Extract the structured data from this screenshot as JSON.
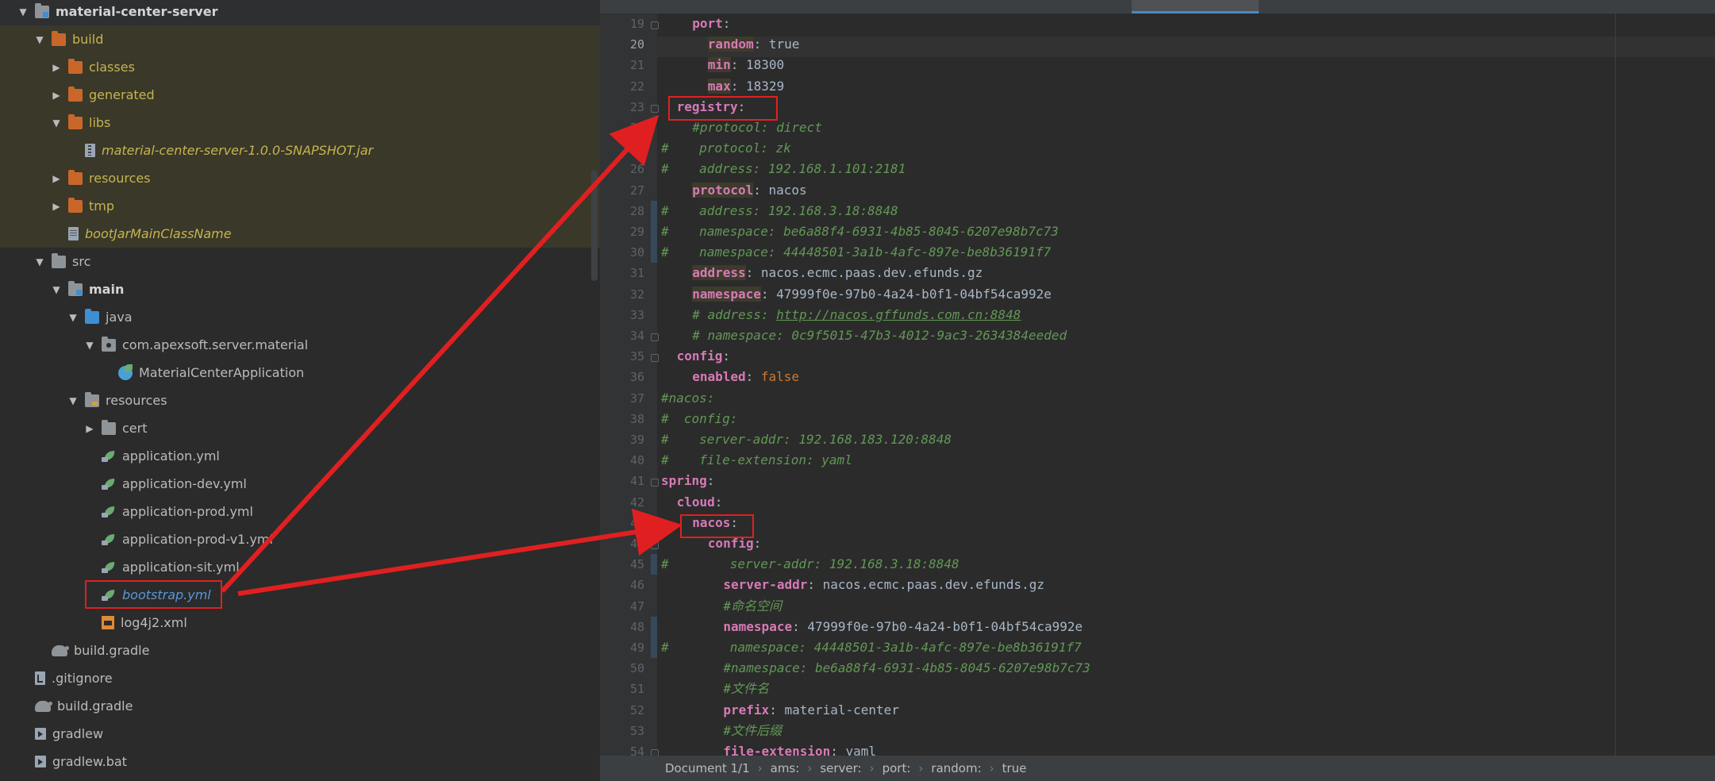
{
  "tree": {
    "items": [
      {
        "label": "material-center-server",
        "depth": 0,
        "expanded": true,
        "icon": "module-folder-icon",
        "style": "bold"
      },
      {
        "label": "build",
        "depth": 1,
        "expanded": true,
        "icon": "folder-orange-icon",
        "style": "yellow"
      },
      {
        "label": "classes",
        "depth": 2,
        "expanded": false,
        "icon": "folder-orange-icon",
        "style": "yellow"
      },
      {
        "label": "generated",
        "depth": 2,
        "expanded": false,
        "icon": "folder-orange-icon",
        "style": "yellow"
      },
      {
        "label": "libs",
        "depth": 2,
        "expanded": true,
        "icon": "folder-orange-icon",
        "style": "yellow"
      },
      {
        "label": "material-center-server-1.0.0-SNAPSHOT.jar",
        "depth": 3,
        "expanded": null,
        "icon": "jar-file-icon",
        "style": "yellow"
      },
      {
        "label": "resources",
        "depth": 2,
        "expanded": false,
        "icon": "folder-orange-icon",
        "style": "yellow"
      },
      {
        "label": "tmp",
        "depth": 2,
        "expanded": false,
        "icon": "folder-orange-icon",
        "style": "yellow"
      },
      {
        "label": "bootJarMainClassName",
        "depth": 2,
        "expanded": null,
        "icon": "generic-file-icon",
        "style": "yellow"
      },
      {
        "label": "src",
        "depth": 1,
        "expanded": true,
        "icon": "folder-gray-icon",
        "style": "white"
      },
      {
        "label": "main",
        "depth": 2,
        "expanded": true,
        "icon": "module-folder-icon",
        "style": "bold"
      },
      {
        "label": "java",
        "depth": 3,
        "expanded": true,
        "icon": "folder-blue-icon",
        "style": "white"
      },
      {
        "label": "com.apexsoft.server.material",
        "depth": 4,
        "expanded": true,
        "icon": "package-icon",
        "style": "white"
      },
      {
        "label": "MaterialCenterApplication",
        "depth": 5,
        "expanded": null,
        "icon": "spring-app-icon",
        "style": "white"
      },
      {
        "label": "resources",
        "depth": 3,
        "expanded": true,
        "icon": "resources-folder-icon",
        "style": "white"
      },
      {
        "label": "cert",
        "depth": 4,
        "expanded": false,
        "icon": "folder-gray-icon",
        "style": "white"
      },
      {
        "label": "application.yml",
        "depth": 4,
        "expanded": null,
        "icon": "spring-yml-icon",
        "style": "white"
      },
      {
        "label": "application-dev.yml",
        "depth": 4,
        "expanded": null,
        "icon": "spring-yml-icon",
        "style": "white"
      },
      {
        "label": "application-prod.yml",
        "depth": 4,
        "expanded": null,
        "icon": "spring-yml-icon",
        "style": "white"
      },
      {
        "label": "application-prod-v1.yml",
        "depth": 4,
        "expanded": null,
        "icon": "spring-yml-icon",
        "style": "white"
      },
      {
        "label": "application-sit.yml",
        "depth": 4,
        "expanded": null,
        "icon": "spring-yml-icon",
        "style": "white"
      },
      {
        "label": "bootstrap.yml",
        "depth": 4,
        "expanded": null,
        "icon": "spring-yml-icon",
        "style": "blue"
      },
      {
        "label": "log4j2.xml",
        "depth": 4,
        "expanded": null,
        "icon": "xml-file-icon",
        "style": "white"
      },
      {
        "label": "build.gradle",
        "depth": 1,
        "expanded": null,
        "icon": "gradle-icon",
        "style": "white"
      },
      {
        "label": ".gitignore",
        "depth": 0,
        "expanded": null,
        "icon": "gitignore-icon",
        "style": "white"
      },
      {
        "label": "build.gradle",
        "depth": 0,
        "expanded": null,
        "icon": "gradle-icon",
        "style": "white"
      },
      {
        "label": "gradlew",
        "depth": 0,
        "expanded": null,
        "icon": "terminal-file-icon",
        "style": "white"
      },
      {
        "label": "gradlew.bat",
        "depth": 0,
        "expanded": null,
        "icon": "terminal-file-icon",
        "style": "white"
      }
    ]
  },
  "editor": {
    "current_line": 20,
    "lines": [
      {
        "n": 19,
        "indent": 4,
        "parts": [
          [
            "key",
            "port"
          ],
          [
            "val",
            ":"
          ]
        ]
      },
      {
        "n": 20,
        "indent": 6,
        "parts": [
          [
            "keybg",
            "random"
          ],
          [
            "val",
            ": "
          ],
          [
            "val",
            "true"
          ]
        ]
      },
      {
        "n": 21,
        "indent": 6,
        "parts": [
          [
            "keybg",
            "min"
          ],
          [
            "val",
            ": 18300"
          ]
        ]
      },
      {
        "n": 22,
        "indent": 6,
        "parts": [
          [
            "keybg",
            "max"
          ],
          [
            "val",
            ": 18329"
          ]
        ]
      },
      {
        "n": 23,
        "indent": 2,
        "parts": [
          [
            "key",
            "registry"
          ],
          [
            "val",
            ":"
          ]
        ]
      },
      {
        "n": 24,
        "indent": 4,
        "parts": [
          [
            "cm",
            "#protocol: direct"
          ]
        ]
      },
      {
        "n": 25,
        "indent": 0,
        "parts": [
          [
            "cm",
            "#    protocol: zk"
          ]
        ]
      },
      {
        "n": 26,
        "indent": 0,
        "parts": [
          [
            "cm",
            "#    address: 192.168.1.101:2181"
          ]
        ]
      },
      {
        "n": 27,
        "indent": 4,
        "parts": [
          [
            "keybg",
            "protocol"
          ],
          [
            "val",
            ": nacos"
          ]
        ]
      },
      {
        "n": 28,
        "indent": 0,
        "parts": [
          [
            "cm",
            "#    address: 192.168.3.18:8848"
          ]
        ]
      },
      {
        "n": 29,
        "indent": 0,
        "parts": [
          [
            "cm",
            "#    namespace: be6a88f4-6931-4b85-8045-6207e98b7c73"
          ]
        ]
      },
      {
        "n": 30,
        "indent": 0,
        "parts": [
          [
            "cm",
            "#    namespace: 44448501-3a1b-4afc-897e-be8b36191f7"
          ]
        ]
      },
      {
        "n": 31,
        "indent": 4,
        "parts": [
          [
            "keybg",
            "address"
          ],
          [
            "val",
            ": nacos.ecmc.paas.dev.efunds.gz"
          ]
        ]
      },
      {
        "n": 32,
        "indent": 4,
        "parts": [
          [
            "keybg",
            "namespace"
          ],
          [
            "val",
            ": 47999f0e-97b0-4a24-b0f1-04bf54ca992e"
          ]
        ]
      },
      {
        "n": 33,
        "indent": 4,
        "parts": [
          [
            "cm",
            "# address: "
          ],
          [
            "link",
            "http://nacos.gffunds.com.cn:8848"
          ]
        ]
      },
      {
        "n": 34,
        "indent": 4,
        "parts": [
          [
            "cm",
            "# namespace: 0c9f5015-47b3-4012-9ac3-2634384eeded"
          ]
        ]
      },
      {
        "n": 35,
        "indent": 2,
        "parts": [
          [
            "key",
            "config"
          ],
          [
            "val",
            ":"
          ]
        ]
      },
      {
        "n": 36,
        "indent": 4,
        "parts": [
          [
            "key",
            "enabled"
          ],
          [
            "val",
            ": "
          ],
          [
            "bool",
            "false"
          ]
        ]
      },
      {
        "n": 37,
        "indent": 0,
        "parts": [
          [
            "cm",
            "#nacos:"
          ]
        ]
      },
      {
        "n": 38,
        "indent": 0,
        "parts": [
          [
            "cm",
            "#  config:"
          ]
        ]
      },
      {
        "n": 39,
        "indent": 0,
        "parts": [
          [
            "cm",
            "#    server-addr: 192.168.183.120:8848"
          ]
        ]
      },
      {
        "n": 40,
        "indent": 0,
        "parts": [
          [
            "cm",
            "#    file-extension: yaml"
          ]
        ]
      },
      {
        "n": 41,
        "indent": 0,
        "parts": [
          [
            "key",
            "spring"
          ],
          [
            "val",
            ":"
          ]
        ]
      },
      {
        "n": 42,
        "indent": 2,
        "parts": [
          [
            "key",
            "cloud"
          ],
          [
            "val",
            ":"
          ]
        ]
      },
      {
        "n": 43,
        "indent": 4,
        "parts": [
          [
            "key",
            "nacos"
          ],
          [
            "val",
            ":"
          ]
        ]
      },
      {
        "n": 44,
        "indent": 6,
        "parts": [
          [
            "key",
            "config"
          ],
          [
            "val",
            ":"
          ]
        ]
      },
      {
        "n": 45,
        "indent": 0,
        "parts": [
          [
            "cm",
            "#        server-addr: 192.168.3.18:8848"
          ]
        ]
      },
      {
        "n": 46,
        "indent": 8,
        "parts": [
          [
            "key",
            "server-addr"
          ],
          [
            "val",
            ": nacos.ecmc.paas.dev.efunds.gz"
          ]
        ]
      },
      {
        "n": 47,
        "indent": 8,
        "parts": [
          [
            "cm",
            "#命名空间"
          ]
        ]
      },
      {
        "n": 48,
        "indent": 8,
        "parts": [
          [
            "key",
            "namespace"
          ],
          [
            "val",
            ": 47999f0e-97b0-4a24-b0f1-04bf54ca992e"
          ]
        ]
      },
      {
        "n": 49,
        "indent": 0,
        "parts": [
          [
            "cm",
            "#        namespace: 44448501-3a1b-4afc-897e-be8b36191f7"
          ]
        ]
      },
      {
        "n": 50,
        "indent": 8,
        "parts": [
          [
            "cm",
            "#namespace: be6a88f4-6931-4b85-8045-6207e98b7c73"
          ]
        ]
      },
      {
        "n": 51,
        "indent": 8,
        "parts": [
          [
            "cm",
            "#文件名"
          ]
        ]
      },
      {
        "n": 52,
        "indent": 8,
        "parts": [
          [
            "key",
            "prefix"
          ],
          [
            "val",
            ": material-center"
          ]
        ]
      },
      {
        "n": 53,
        "indent": 8,
        "parts": [
          [
            "cm",
            "#文件后缀"
          ]
        ]
      },
      {
        "n": 54,
        "indent": 8,
        "parts": [
          [
            "key",
            "file-extension"
          ],
          [
            "val",
            ": yaml"
          ]
        ]
      }
    ]
  },
  "status": {
    "crumbs": [
      "Document 1/1",
      "ams:",
      "server:",
      "port:",
      "random:",
      "true"
    ]
  },
  "colors": {
    "annotation": "#e02020",
    "key": "#d77ab6",
    "comment": "#629755",
    "folder_build": "#c9672a"
  }
}
